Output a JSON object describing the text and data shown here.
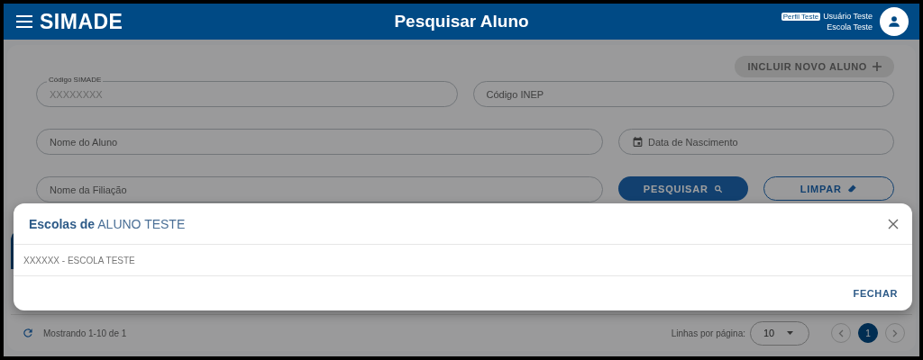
{
  "header": {
    "logo": "SIMADE",
    "title": "Pesquisar Aluno",
    "profile_badge": "Perfil Teste",
    "user_name": "Usuário Teste",
    "school": "Escola Teste"
  },
  "search_form": {
    "add_button": {
      "label": "INCLUIR NOVO ALUNO",
      "disabled": true
    },
    "fields": [
      {
        "kind": "text",
        "label": "Código SIMADE",
        "value": "XXXXXXXX"
      },
      {
        "kind": "text",
        "placeholder": "Código INEP"
      },
      {
        "kind": "text",
        "placeholder": "Nome do Aluno"
      },
      {
        "kind": "date",
        "placeholder": "Data de Nascimento"
      },
      {
        "kind": "text",
        "placeholder": "Nome da Filiação"
      }
    ],
    "search_button": "PESQUISAR",
    "clear_button": "LIMPAR"
  },
  "table_footer": {
    "summary": "Mostrando 1-10 de 1",
    "rows_per_page_label": "Linhas por página:",
    "rows_per_page": "10",
    "pages": [
      {
        "label": "1",
        "selected": true
      }
    ]
  },
  "dialog": {
    "title": "**Escolas de** ALUNO TESTE",
    "items": [
      "XXXXXX - ESCOLA TESTE"
    ],
    "close_button": "FECHAR"
  }
}
